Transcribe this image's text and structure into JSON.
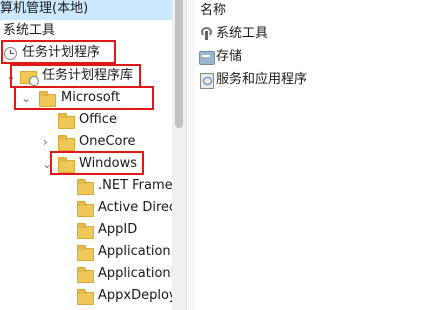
{
  "tree": {
    "root_label": "算机管理(本地)",
    "system_tools_label": "系统工具",
    "task_scheduler_label": "任务计划程序",
    "task_library_label": "任务计划程序库",
    "microsoft_label": "Microsoft",
    "office_label": "Office",
    "onecore_label": "OneCore",
    "windows_label": "Windows",
    "children": [
      {
        "label": ".NET Framew"
      },
      {
        "label": "Active Direc"
      },
      {
        "label": "AppID"
      },
      {
        "label": "Application"
      },
      {
        "label": "ApplicationI"
      },
      {
        "label": "AppxDeploy"
      }
    ],
    "icons": {
      "expand": "chevron-right-icon",
      "collapse": "chevron-down-icon",
      "folder": "folder-icon",
      "scheduler": "clock-icon"
    }
  },
  "detail": {
    "column_header": "名称",
    "items": [
      {
        "label": "系统工具",
        "icon": "tools-icon"
      },
      {
        "label": "存储",
        "icon": "storage-icon"
      },
      {
        "label": "服务和应用程序",
        "icon": "services-icon"
      }
    ]
  },
  "colors": {
    "highlight_border": "#e01818",
    "selected_row": "#cce8ff",
    "folder": "#f0c85a"
  }
}
